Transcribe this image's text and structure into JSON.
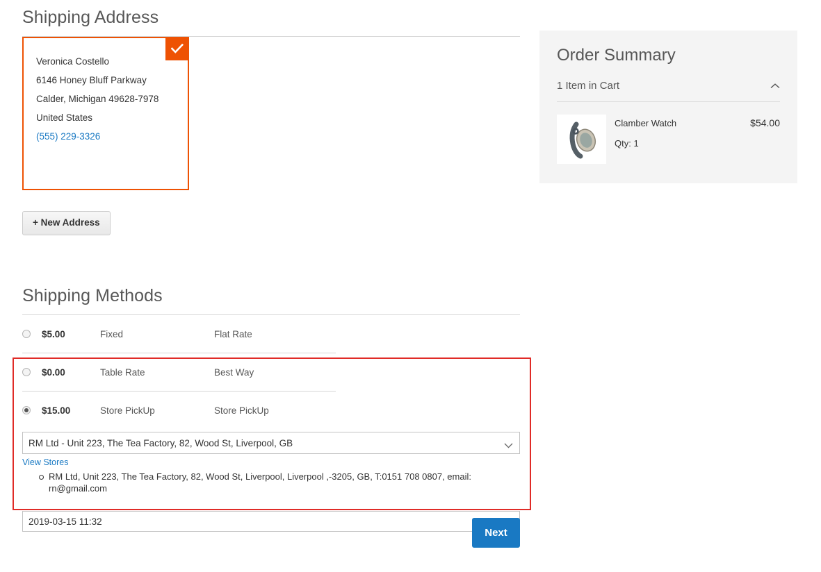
{
  "shipping_address": {
    "heading": "Shipping Address",
    "selected_badge_icon": "check-icon",
    "card": {
      "name": "Veronica Costello",
      "street": "6146 Honey Bluff Parkway",
      "city_state_zip": "Calder, Michigan 49628-7978",
      "country": "United States",
      "phone": "(555) 229-3326"
    },
    "new_address_button": "+ New Address"
  },
  "shipping_methods": {
    "heading": "Shipping Methods",
    "rows": [
      {
        "price": "$5.00",
        "carrier": "Fixed",
        "name": "Flat Rate",
        "selected": false
      },
      {
        "price": "$0.00",
        "carrier": "Table Rate",
        "name": "Best Way",
        "selected": false
      },
      {
        "price": "$15.00",
        "carrier": "Store PickUp",
        "name": "Store PickUp",
        "selected": true
      }
    ],
    "pickup": {
      "store_select_value": "RM Ltd - Unit 223, The Tea Factory, 82, Wood St, Liverpool, GB",
      "select_chevron_icon": "chevron-down-icon",
      "view_stores_link": "View Stores",
      "store_details": "RM Ltd, Unit 223, The Tea Factory, 82, Wood St, Liverpool, Liverpool ,-3205, GB, T:0151 708 0807, email: rn@gmail.com",
      "datetime_value": "2019-03-15 11:32",
      "datetime_placeholder": "2019-03-15 11:32"
    }
  },
  "next_button": "Next",
  "order_summary": {
    "title": "Order Summary",
    "cart_label": "1 Item in Cart",
    "collapse_icon": "chevron-up-icon",
    "items": [
      {
        "thumb_icon": "watch-product-image",
        "name": "Clamber Watch",
        "qty": "Qty: 1",
        "price": "$54.00"
      }
    ]
  },
  "colors": {
    "accent_orange": "#ee5203",
    "link_blue": "#1979c3",
    "highlight_red": "#e02b27",
    "panel_gray": "#f4f4f4"
  }
}
